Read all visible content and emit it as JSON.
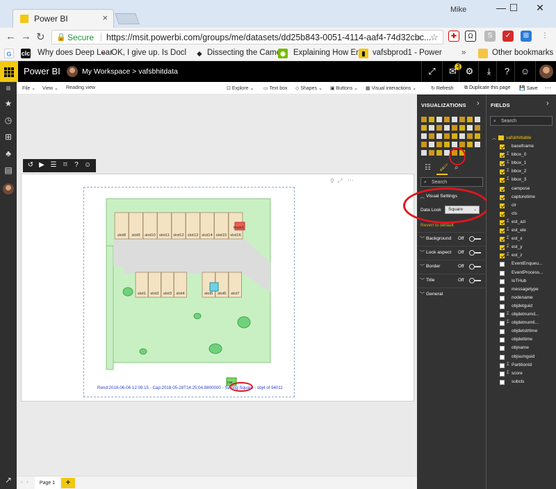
{
  "browser": {
    "tab_title": "Power BI",
    "user_name": "Mike",
    "secure_label": "Secure",
    "url": "https://msit.powerbi.com/groups/me/datasets/dd25b843-0051-4114-aaf4-74d32cbc...",
    "bookmarks": [
      "Why does Deep Lear",
      "OK, I give up. Is Docl",
      "Dissecting the Came",
      "Explaining How End",
      "vafsbprod1 - Power",
      "Other bookmarks"
    ]
  },
  "pbi_header": {
    "app_name": "Power BI",
    "workspace": "My Workspace",
    "dataset": "vafsbhitdata",
    "notification_count": "2"
  },
  "toolbar": {
    "file": "File",
    "view": "View",
    "reading_view": "Reading view",
    "explore": "Explore",
    "text_box": "Text box",
    "shapes": "Shapes",
    "buttons": "Buttons",
    "visual_interactions": "Visual interactions",
    "refresh": "Refresh",
    "duplicate_page": "Duplicate this page",
    "save": "Save"
  },
  "visual": {
    "slots_top": [
      "slot8",
      "slot9",
      "slot10",
      "slot11",
      "slot12",
      "slot13",
      "slot14",
      "slot15",
      "slot16"
    ],
    "slots_bottom_left": [
      "slot1",
      "slot2",
      "slot3",
      "slot4"
    ],
    "slots_bottom_right": [
      "slot5",
      "slot6",
      "slot7"
    ],
    "truck_label": "truck1",
    "car_label": "car",
    "caption": "Rend:2018-06-06 12:09:15 - Cap:2018-05-28T14:25:04.8800000 - Setting:Square - obj4 of 94011"
  },
  "pages": {
    "page_tab": "Page 1",
    "add_label": "+"
  },
  "visualizations": {
    "title": "VISUALIZATIONS",
    "search_placeholder": "Search",
    "visual_settings": "Visual Settings",
    "data_look_label": "Data Look",
    "data_look_value": "Square",
    "revert": "Revert to default",
    "sections": [
      {
        "label": "Background",
        "state": "Off"
      },
      {
        "label": "Lock aspect",
        "state": "Off"
      },
      {
        "label": "Border",
        "state": "Off"
      },
      {
        "label": "Title",
        "state": "Off"
      }
    ],
    "general": "General"
  },
  "fields": {
    "title": "FIELDS",
    "search_placeholder": "Search",
    "table_name": "vafsbhittable",
    "items": [
      {
        "name": "basefname",
        "checked": true,
        "sigma": false
      },
      {
        "name": "bbox_0",
        "checked": true,
        "sigma": true
      },
      {
        "name": "bbox_1",
        "checked": true,
        "sigma": true
      },
      {
        "name": "bbox_2",
        "checked": true,
        "sigma": true
      },
      {
        "name": "bbox_3",
        "checked": true,
        "sigma": true
      },
      {
        "name": "campose",
        "checked": true,
        "sigma": false
      },
      {
        "name": "capturetime",
        "checked": true,
        "sigma": false
      },
      {
        "name": "clr",
        "checked": true,
        "sigma": false
      },
      {
        "name": "cls",
        "checked": true,
        "sigma": false
      },
      {
        "name": "est_azi",
        "checked": true,
        "sigma": true
      },
      {
        "name": "est_ele",
        "checked": true,
        "sigma": true
      },
      {
        "name": "est_x",
        "checked": true,
        "sigma": true
      },
      {
        "name": "est_y",
        "checked": true,
        "sigma": true
      },
      {
        "name": "est_z",
        "checked": true,
        "sigma": true
      },
      {
        "name": "EventEnqueu...",
        "checked": false,
        "sigma": false
      },
      {
        "name": "EventProcess...",
        "checked": false,
        "sigma": false
      },
      {
        "name": "IoTHub",
        "checked": false,
        "sigma": false
      },
      {
        "name": "messagetype",
        "checked": false,
        "sigma": false
      },
      {
        "name": "nodename",
        "checked": false,
        "sigma": false
      },
      {
        "name": "objdetguid",
        "checked": false,
        "sigma": false
      },
      {
        "name": "objdetnumd...",
        "checked": false,
        "sigma": true
      },
      {
        "name": "objdetnumti...",
        "checked": false,
        "sigma": true
      },
      {
        "name": "objdetstrtime",
        "checked": false,
        "sigma": false
      },
      {
        "name": "objdettime",
        "checked": false,
        "sigma": false
      },
      {
        "name": "objname",
        "checked": false,
        "sigma": false
      },
      {
        "name": "objsumguid",
        "checked": false,
        "sigma": false
      },
      {
        "name": "PartitionId",
        "checked": false,
        "sigma": true
      },
      {
        "name": "score",
        "checked": false,
        "sigma": true
      },
      {
        "name": "subcls",
        "checked": false,
        "sigma": false
      }
    ]
  },
  "colors": {
    "brand_yellow": "#f2c811",
    "pane_bg": "#333333",
    "highlight_red": "#e0161e",
    "map_green": "#c9f0c3"
  }
}
